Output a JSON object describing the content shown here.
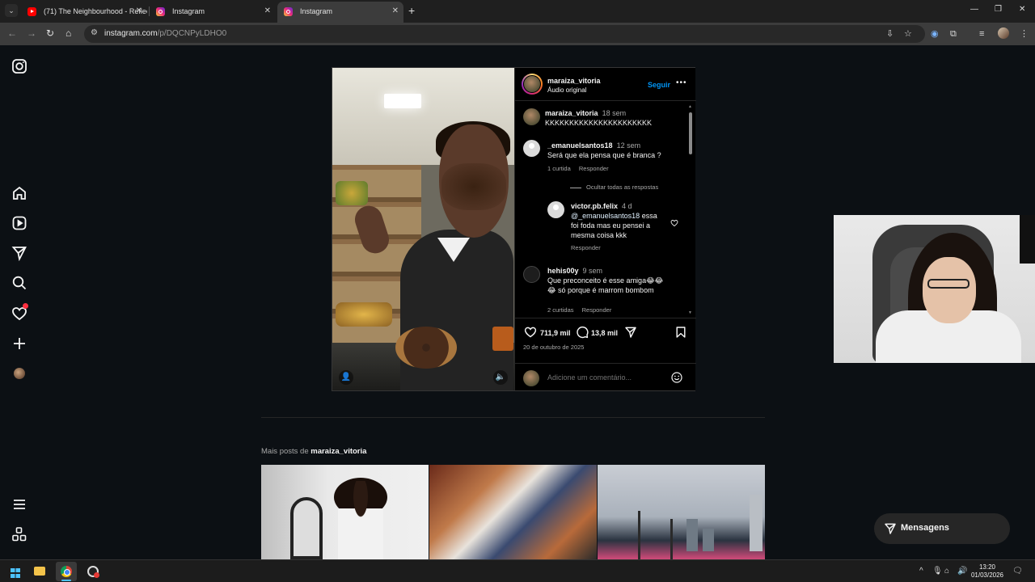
{
  "browser": {
    "tabs": [
      {
        "title": "(71) The Neighbourhood - Reflec",
        "favicon": "youtube-icon"
      },
      {
        "title": "Instagram",
        "favicon": "instagram-icon"
      },
      {
        "title": "Instagram",
        "favicon": "instagram-icon",
        "active": true
      }
    ],
    "url_domain": "instagram.com",
    "url_path": "/p/DQCNPyLDHO0"
  },
  "sidebar": {
    "items": [
      "instagram-logo-icon",
      "home-icon",
      "reels-icon",
      "direct-icon",
      "search-icon",
      "heart-icon",
      "create-icon",
      "profile-avatar",
      "menu-icon",
      "apps-icon"
    ]
  },
  "post": {
    "header": {
      "username": "maraiza_vitoria",
      "subtitle": "Áudio original",
      "follow_label": "Seguir",
      "more_label": "•••"
    },
    "comments": [
      {
        "username": "maraiza_vitoria",
        "time": "18 sem",
        "text": "KKKKKKKKKKKKKKKKKKKKKK"
      },
      {
        "username": "_emanuelsantos18",
        "time": "12 sem",
        "text": "Será que ela pensa que é branca ?",
        "likes": "1 curtida",
        "reply": "Responder",
        "hide_replies": "Ocultar todas as respostas"
      },
      {
        "username": "victor.pb.felix",
        "time": "4 d",
        "mention": "@_emanuelsantos18",
        "text": " essa foi foda mas eu pensei a mesma coisa kkk",
        "reply": "Responder"
      },
      {
        "username": "hehis00y",
        "time": "9 sem",
        "text": "Que preconceito é esse amiga😂😂 😂 só porque é marrom bombom",
        "likes": "2 curtidas",
        "reply": "Responder"
      }
    ],
    "likes": "711,9 mil",
    "comment_count": "13,8 mil",
    "date": "20 de outubro de 2025",
    "add_comment_placeholder": "Adicione um comentário..."
  },
  "more_posts": {
    "prefix": "Mais posts de ",
    "username": "maraiza_vitoria"
  },
  "messages_button": "Mensagens",
  "taskbar": {
    "time": "13:20",
    "date": "01/03/2026"
  }
}
